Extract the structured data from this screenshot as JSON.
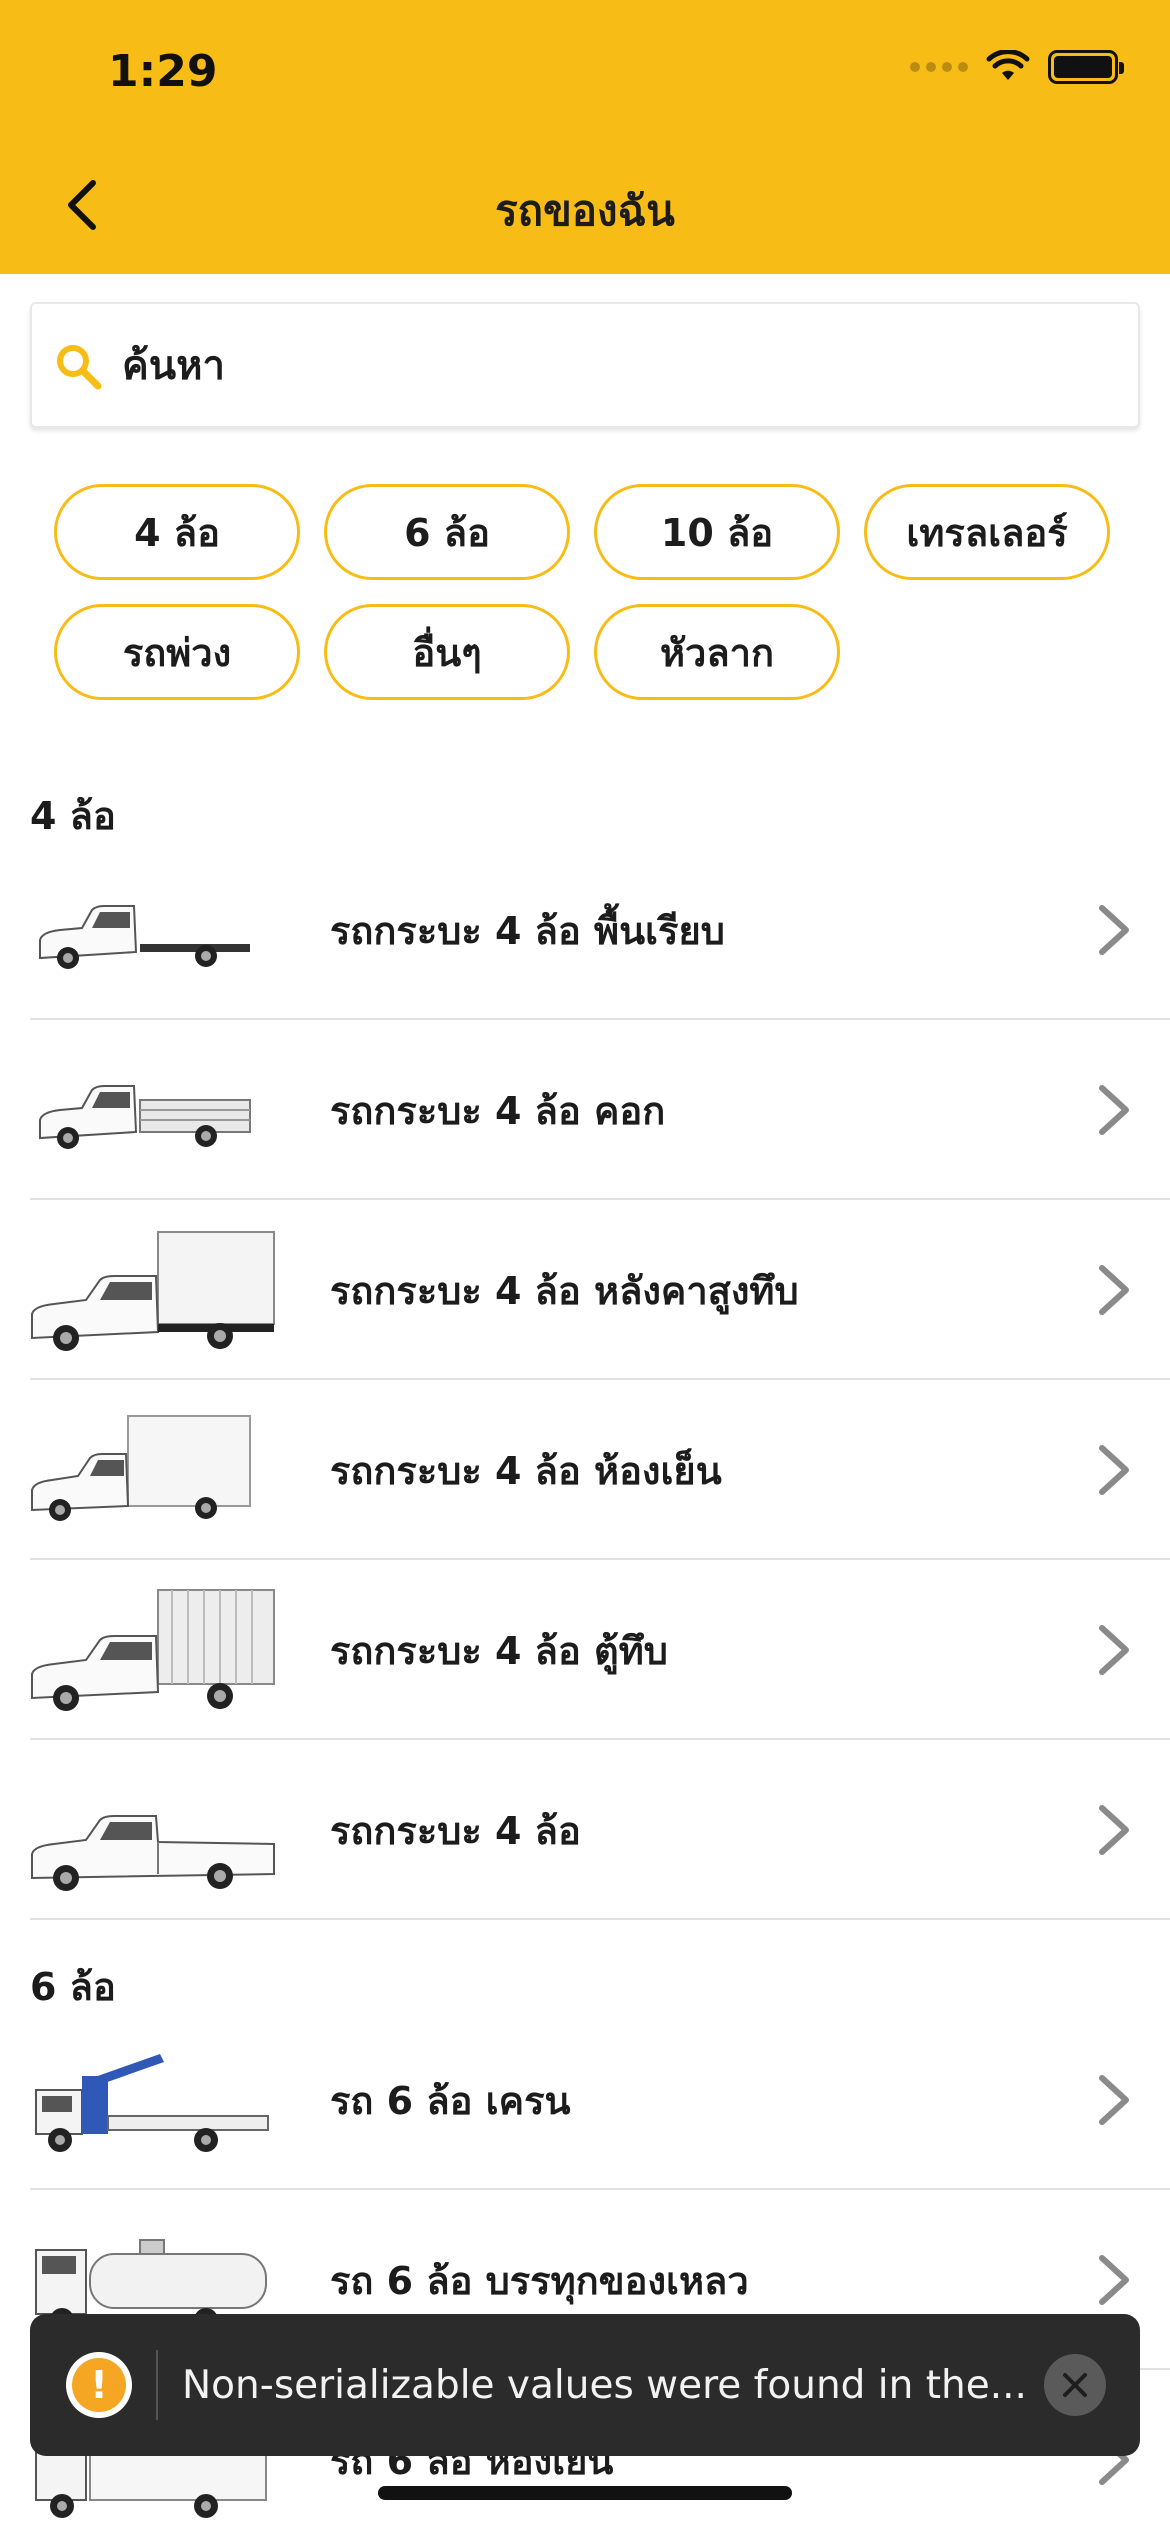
{
  "status_bar": {
    "time": "1:29"
  },
  "header": {
    "title": "รถของฉัน"
  },
  "search": {
    "placeholder": "ค้นหา"
  },
  "filters": [
    "4 ล้อ",
    "6 ล้อ",
    "10 ล้อ",
    "เทรลเลอร์",
    "รถพ่วง",
    "อื่นๆ",
    "หัวลาก"
  ],
  "sections": [
    {
      "title": "4 ล้อ",
      "items": [
        "รถกระบะ 4 ล้อ พื้นเรียบ",
        "รถกระบะ 4 ล้อ คอก",
        "รถกระบะ 4 ล้อ หลังคาสูงทึบ",
        "รถกระบะ 4 ล้อ ห้องเย็น",
        "รถกระบะ 4 ล้อ ตู้ทึบ",
        "รถกระบะ 4 ล้อ"
      ]
    },
    {
      "title": "6 ล้อ",
      "items": [
        "รถ 6 ล้อ เครน",
        "รถ 6 ล้อ บรรทุกของเหลว",
        "รถ 6 ล้อ ห้องเย็น"
      ]
    }
  ],
  "toast": {
    "message": "Non-serializable values were found in the..."
  },
  "colors": {
    "accent": "#F8BC16",
    "toast_bg": "#2b2b2b",
    "warning": "#F5A623"
  }
}
